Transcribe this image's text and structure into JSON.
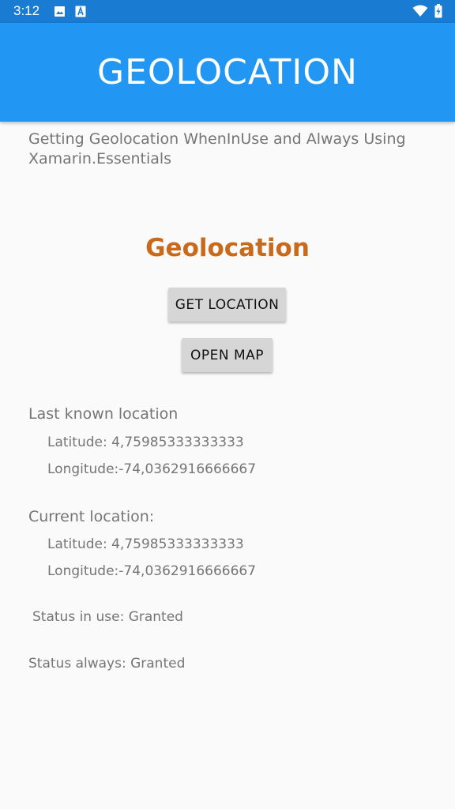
{
  "status_bar": {
    "time": "3:12",
    "left_icons": [
      "image-icon",
      "text-a-icon"
    ],
    "right_icons": [
      "wifi-icon",
      "battery-charging-icon"
    ]
  },
  "app_bar": {
    "title": "GEOLOCATION",
    "color": "#2196f3"
  },
  "content": {
    "subtitle": "Getting Geolocation WhenInUse and Always Using Xamarin.Essentials",
    "heading": "Geolocation",
    "heading_color": "#c8691c",
    "buttons": {
      "get_location": "GET LOCATION",
      "open_map": "OPEN MAP"
    },
    "last_known": {
      "label": "Last known location",
      "latitude": "Latitude: 4,75985333333333",
      "longitude": "Longitude:-74,0362916666667"
    },
    "current": {
      "label": "Current location:",
      "latitude": "Latitude: 4,75985333333333",
      "longitude": "Longitude:-74,0362916666667"
    },
    "status_in_use": "Status in use: Granted",
    "status_always": "Status always: Granted"
  }
}
